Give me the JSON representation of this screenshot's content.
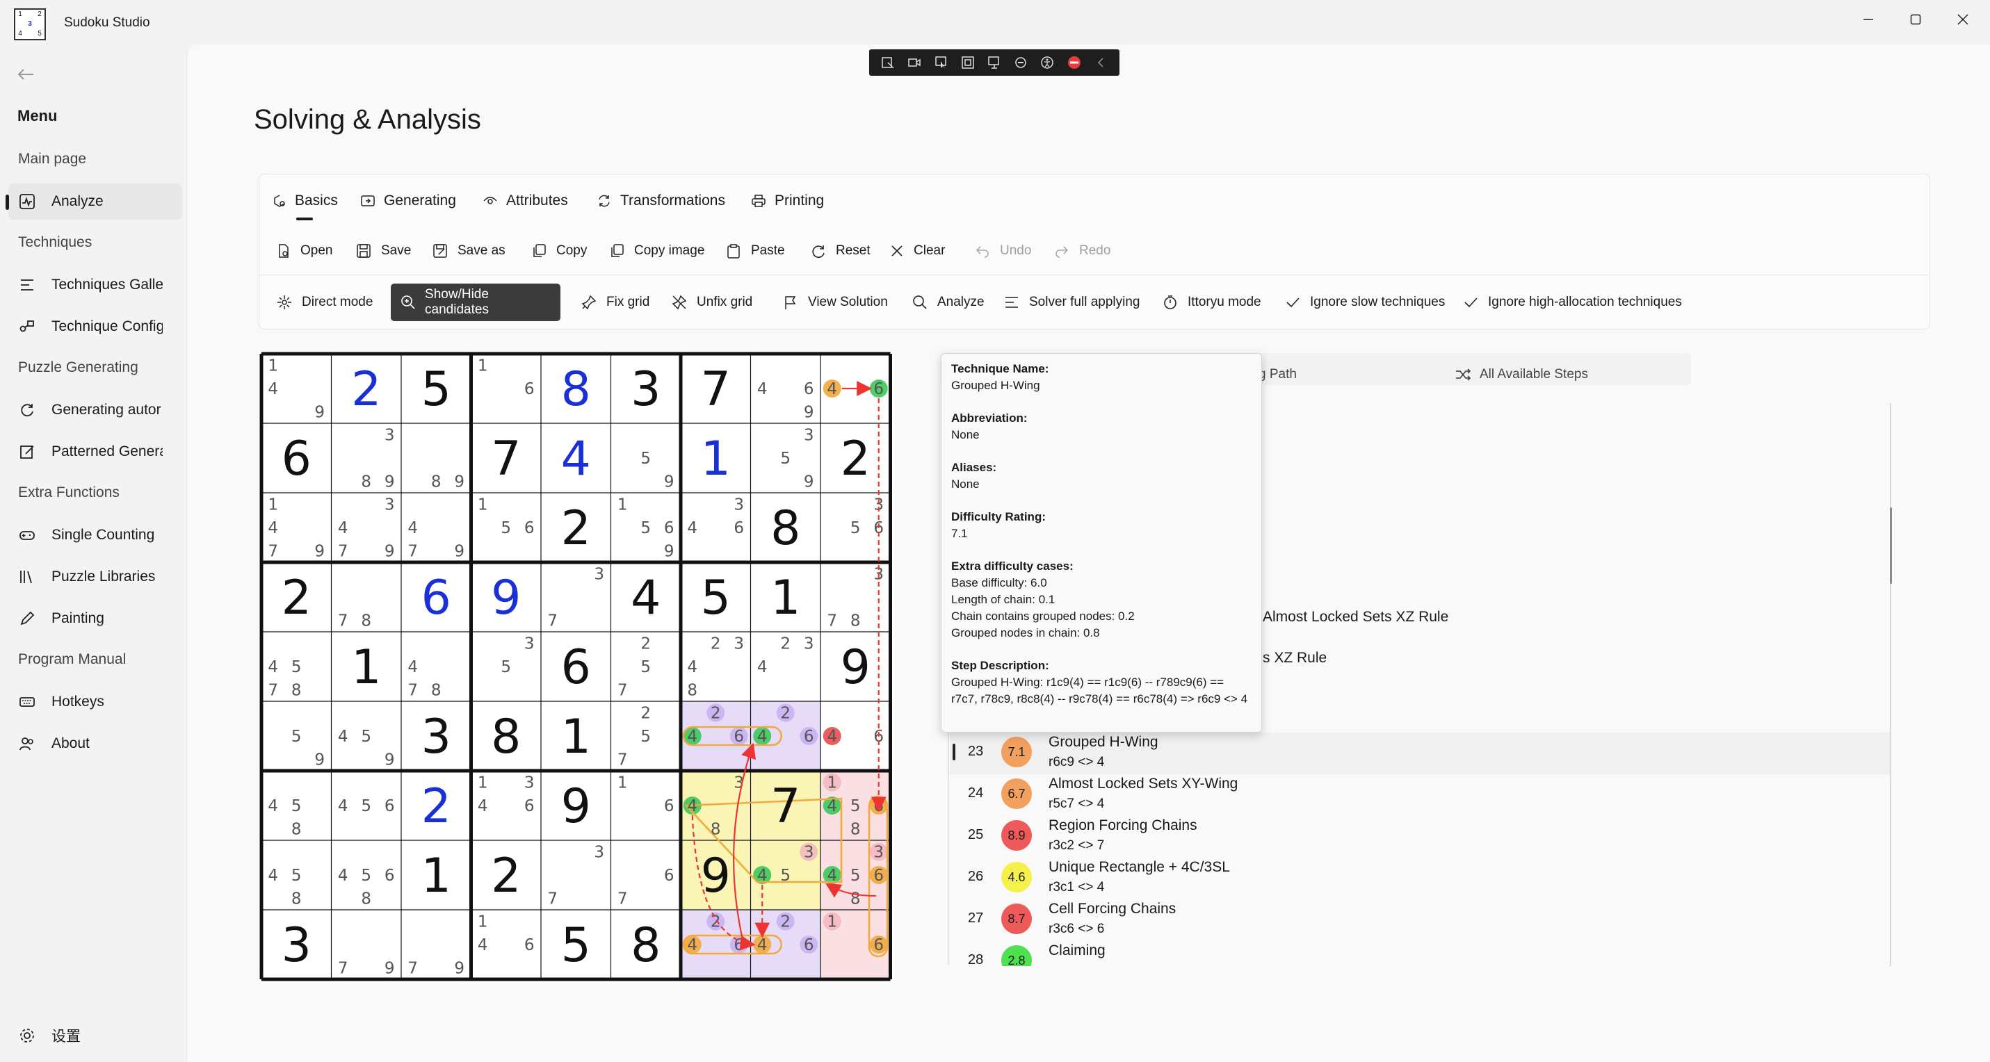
{
  "window": {
    "title": "Sudoku Studio",
    "icon_digits": [
      "1",
      "",
      "2",
      "",
      "3",
      "",
      "4",
      "",
      "5"
    ]
  },
  "sidebar": {
    "menu_label": "Menu",
    "sections": {
      "main_page": "Main page",
      "analyze": "Analyze",
      "techniques": "Techniques",
      "techniques_gallery": "Techniques Galle",
      "technique_config": "Technique Config",
      "puzzle_generating": "Puzzle Generating",
      "generating_auto": "Generating autor",
      "patterned": "Patterned Genera",
      "extra_functions": "Extra Functions",
      "single_counting": "Single Counting",
      "puzzle_libraries": "Puzzle Libraries",
      "painting": "Painting",
      "program_manual": "Program Manual",
      "hotkeys": "Hotkeys",
      "about": "About",
      "settings": "设置"
    }
  },
  "page": {
    "title": "Solving & Analysis"
  },
  "tabs": [
    "Basics",
    "Generating",
    "Attributes",
    "Transformations",
    "Printing"
  ],
  "toolbar1": {
    "open": "Open",
    "save": "Save",
    "save_as": "Save as",
    "copy": "Copy",
    "copy_image": "Copy image",
    "paste": "Paste",
    "reset": "Reset",
    "clear": "Clear",
    "undo": "Undo",
    "redo": "Redo"
  },
  "toolbar2": {
    "direct_mode": "Direct mode",
    "show_hide": "Show/Hide candidates",
    "fix_grid": "Fix grid",
    "unfix_grid": "Unfix grid",
    "view_solution": "View Solution",
    "analyze": "Analyze",
    "solver_full": "Solver full applying",
    "ittoryu": "Ittoryu mode",
    "ignore_slow": "Ignore slow techniques",
    "ignore_high": "Ignore high-allocation techniques"
  },
  "colors": {
    "given": "#111111",
    "blue": "#1a2fd6",
    "chain_green": "#3cc85a",
    "chain_orange": "#f2a93b",
    "chain_red": "#e84c4c",
    "purple_cell": "#e7dcf8",
    "yellow_cell": "#fbf5b5",
    "red_cell": "#fbe0e3",
    "yellow_cell2": "#fdeec0"
  },
  "sudoku": {
    "cells": [
      {
        "v": "",
        "c": [
          "1",
          "",
          "",
          "4",
          "",
          "",
          "",
          "",
          "9"
        ]
      },
      {
        "v": "2",
        "t": "b"
      },
      {
        "v": "5",
        "t": "g"
      },
      {
        "v": "",
        "c": [
          "1",
          "",
          "",
          "",
          "",
          "6",
          "",
          "",
          ""
        ]
      },
      {
        "v": "8",
        "t": "b"
      },
      {
        "v": "3",
        "t": "g"
      },
      {
        "v": "7",
        "t": "g"
      },
      {
        "v": "",
        "c": [
          "",
          "",
          "",
          "4",
          "",
          "6",
          "",
          "",
          "9"
        ]
      },
      {
        "v": "",
        "c": [
          "",
          "",
          "",
          "4",
          "",
          "6",
          "",
          "",
          ""
        ]
      },
      {
        "v": "6",
        "t": "g"
      },
      {
        "v": "",
        "c": [
          "",
          "",
          "3",
          "",
          "",
          "",
          "",
          "8",
          "9"
        ]
      },
      {
        "v": "",
        "c": [
          "",
          "",
          "",
          "",
          "",
          "",
          "",
          "8",
          "9"
        ]
      },
      {
        "v": "7",
        "t": "g"
      },
      {
        "v": "4",
        "t": "b"
      },
      {
        "v": "",
        "c": [
          "",
          "",
          "",
          "",
          "5",
          "",
          "",
          "",
          "9"
        ]
      },
      {
        "v": "1",
        "t": "b"
      },
      {
        "v": "",
        "c": [
          "",
          "",
          "3",
          "",
          "5",
          "",
          "",
          "",
          "9"
        ]
      },
      {
        "v": "2",
        "t": "g"
      },
      {
        "v": "",
        "c": [
          "1",
          "",
          "",
          "4",
          "",
          "",
          "7",
          "",
          "9"
        ]
      },
      {
        "v": "",
        "c": [
          "",
          "",
          "3",
          "4",
          "",
          "",
          "7",
          "",
          "9"
        ]
      },
      {
        "v": "",
        "c": [
          "",
          "",
          "",
          "4",
          "",
          "",
          "7",
          "",
          "9"
        ]
      },
      {
        "v": "",
        "c": [
          "1",
          "",
          "",
          "",
          "5",
          "6",
          "",
          "",
          ""
        ]
      },
      {
        "v": "2",
        "t": "g"
      },
      {
        "v": "",
        "c": [
          "1",
          "",
          "",
          "",
          "5",
          "6",
          "",
          "",
          "9"
        ]
      },
      {
        "v": "",
        "c": [
          "",
          "",
          "3",
          "4",
          "",
          "6",
          "",
          "",
          ""
        ]
      },
      {
        "v": "8",
        "t": "g"
      },
      {
        "v": "",
        "c": [
          "",
          "",
          "3",
          "",
          "5",
          "6",
          "",
          "",
          ""
        ]
      },
      {
        "v": "2",
        "t": "g"
      },
      {
        "v": "",
        "c": [
          "",
          "",
          "",
          "",
          "",
          "",
          "7",
          "8",
          ""
        ]
      },
      {
        "v": "6",
        "t": "b"
      },
      {
        "v": "9",
        "t": "b"
      },
      {
        "v": "",
        "c": [
          "",
          "",
          "3",
          "",
          "",
          "",
          "7",
          "",
          ""
        ]
      },
      {
        "v": "4",
        "t": "g"
      },
      {
        "v": "5",
        "t": "g"
      },
      {
        "v": "1",
        "t": "g"
      },
      {
        "v": "",
        "c": [
          "",
          "",
          "3",
          "",
          "",
          "",
          "7",
          "8",
          ""
        ]
      },
      {
        "v": "",
        "c": [
          "",
          "",
          "",
          "4",
          "5",
          "",
          "7",
          "8",
          ""
        ]
      },
      {
        "v": "1",
        "t": "g"
      },
      {
        "v": "",
        "c": [
          "",
          "",
          "",
          "4",
          "",
          "",
          "7",
          "8",
          ""
        ]
      },
      {
        "v": "",
        "c": [
          "",
          "",
          "3",
          "",
          "5",
          "",
          "",
          "",
          ""
        ]
      },
      {
        "v": "6",
        "t": "g"
      },
      {
        "v": "",
        "c": [
          "",
          "2",
          "",
          "",
          "5",
          "",
          "7",
          "",
          ""
        ]
      },
      {
        "v": "",
        "c": [
          "",
          "2",
          "3",
          "4",
          "",
          "",
          "8",
          "",
          ""
        ]
      },
      {
        "v": "",
        "c": [
          "",
          "2",
          "3",
          "4",
          "",
          "",
          "",
          "",
          ""
        ]
      },
      {
        "v": "9",
        "t": "g"
      },
      {
        "v": "",
        "c": [
          "",
          "",
          "",
          "",
          "5",
          "",
          "",
          "",
          "9"
        ]
      },
      {
        "v": "",
        "c": [
          "",
          "",
          "",
          "4",
          "5",
          "",
          "",
          "",
          "9"
        ]
      },
      {
        "v": "3",
        "t": "g"
      },
      {
        "v": "8",
        "t": "g"
      },
      {
        "v": "1",
        "t": "g"
      },
      {
        "v": "",
        "c": [
          "",
          "2",
          "",
          "",
          "5",
          "",
          "7",
          "",
          ""
        ]
      },
      {
        "v": "",
        "c": [
          "",
          "2",
          "",
          "4",
          "",
          "6",
          "",
          "",
          ""
        ]
      },
      {
        "v": "",
        "c": [
          "",
          "2",
          "",
          "4",
          "",
          "6",
          "",
          "",
          ""
        ]
      },
      {
        "v": "",
        "c": [
          "",
          "",
          "",
          "4",
          "",
          "6",
          "",
          "",
          ""
        ]
      },
      {
        "v": "",
        "c": [
          "",
          "",
          "",
          "4",
          "5",
          "",
          "",
          "8",
          ""
        ]
      },
      {
        "v": "",
        "c": [
          "",
          "",
          "",
          "4",
          "5",
          "6",
          "",
          "",
          ""
        ]
      },
      {
        "v": "2",
        "t": "b"
      },
      {
        "v": "",
        "c": [
          "1",
          "",
          "3",
          "4",
          "",
          "6",
          "",
          "",
          ""
        ]
      },
      {
        "v": "9",
        "t": "g"
      },
      {
        "v": "",
        "c": [
          "1",
          "",
          "",
          "",
          "",
          "6",
          "",
          "",
          ""
        ]
      },
      {
        "v": "",
        "c": [
          "",
          "",
          "3",
          "4",
          "",
          "",
          "",
          "8",
          ""
        ]
      },
      {
        "v": "7",
        "t": "g"
      },
      {
        "v": "",
        "c": [
          "1",
          "",
          "",
          "4",
          "5",
          "6",
          "",
          "8",
          ""
        ]
      },
      {
        "v": "",
        "c": [
          "",
          "",
          "",
          "4",
          "5",
          "",
          "",
          "8",
          ""
        ]
      },
      {
        "v": "",
        "c": [
          "",
          "",
          "",
          "4",
          "5",
          "6",
          "",
          "8",
          ""
        ]
      },
      {
        "v": "1",
        "t": "g"
      },
      {
        "v": "2",
        "t": "g"
      },
      {
        "v": "",
        "c": [
          "",
          "",
          "3",
          "",
          "",
          "",
          "7",
          "",
          ""
        ]
      },
      {
        "v": "",
        "c": [
          "",
          "",
          "",
          "",
          "",
          "6",
          "7",
          "",
          ""
        ]
      },
      {
        "v": "9",
        "t": "g"
      },
      {
        "v": "",
        "c": [
          "",
          "",
          "3",
          "4",
          "5",
          "",
          "",
          "",
          ""
        ]
      },
      {
        "v": "",
        "c": [
          "",
          "",
          "3",
          "4",
          "5",
          "6",
          "",
          "8",
          ""
        ]
      },
      {
        "v": "3",
        "t": "g"
      },
      {
        "v": "",
        "c": [
          "",
          "",
          "",
          "",
          "",
          "",
          "7",
          "",
          "9"
        ]
      },
      {
        "v": "",
        "c": [
          "",
          "",
          "",
          "",
          "",
          "",
          "7",
          "",
          "9"
        ]
      },
      {
        "v": "",
        "c": [
          "1",
          "",
          "",
          "4",
          "",
          "6",
          "",
          "",
          ""
        ]
      },
      {
        "v": "5",
        "t": "g"
      },
      {
        "v": "8",
        "t": "g"
      },
      {
        "v": "",
        "c": [
          "",
          "2",
          "",
          "4",
          "",
          "6",
          "",
          "",
          ""
        ]
      },
      {
        "v": "",
        "c": [
          "",
          "2",
          "",
          "4",
          "",
          "6",
          "",
          "",
          ""
        ]
      },
      {
        "v": "",
        "c": [
          "1",
          "",
          "",
          "",
          "",
          "6",
          "",
          "",
          ""
        ]
      }
    ]
  },
  "step_tabs": {
    "path": "g Path",
    "all": "All Available Steps"
  },
  "steps_partial": [
    "Almost Locked Sets XZ Rule",
    "s XZ Rule"
  ],
  "steps": [
    {
      "num": "23",
      "rating": "7.1",
      "name": "Grouped H-Wing",
      "desc": "r6c9 <> 4",
      "color": "#f2a060"
    },
    {
      "num": "24",
      "rating": "6.7",
      "name": "Almost Locked Sets XY-Wing",
      "desc": "r5c7 <> 4",
      "color": "#f2a060"
    },
    {
      "num": "25",
      "rating": "8.9",
      "name": "Region Forcing Chains",
      "desc": "r3c2 <> 7",
      "color": "#ee5a5a"
    },
    {
      "num": "26",
      "rating": "4.6",
      "name": "Unique Rectangle + 4C/3SL",
      "desc": "r3c1 <> 4",
      "color": "#f6f04a"
    },
    {
      "num": "27",
      "rating": "8.7",
      "name": "Cell Forcing Chains",
      "desc": "r3c6 <> 6",
      "color": "#ee5a5a"
    },
    {
      "num": "28",
      "rating": "2.8",
      "name": "Claiming",
      "desc": "",
      "color": "#4fe04f"
    }
  ],
  "tooltip": {
    "name_h": "Technique Name:",
    "name": "Grouped H-Wing",
    "abbr_h": "Abbreviation:",
    "abbr": "None",
    "alias_h": "Aliases:",
    "alias": "None",
    "rating_h": "Difficulty Rating:",
    "rating": "7.1",
    "extra_h": "Extra difficulty cases:",
    "extra": [
      "Base difficulty: 6.0",
      "Length of chain: 0.1",
      "Chain contains grouped nodes: 0.2",
      "Grouped nodes in chain: 0.8"
    ],
    "desc_h": "Step Description:",
    "desc": "Grouped H-Wing: r1c9(4) == r1c9(6) -- r789c9(6) == r7c7, r78c9, r8c8(4) -- r9c78(4) == r6c78(4) => r6c9 <> 4"
  }
}
